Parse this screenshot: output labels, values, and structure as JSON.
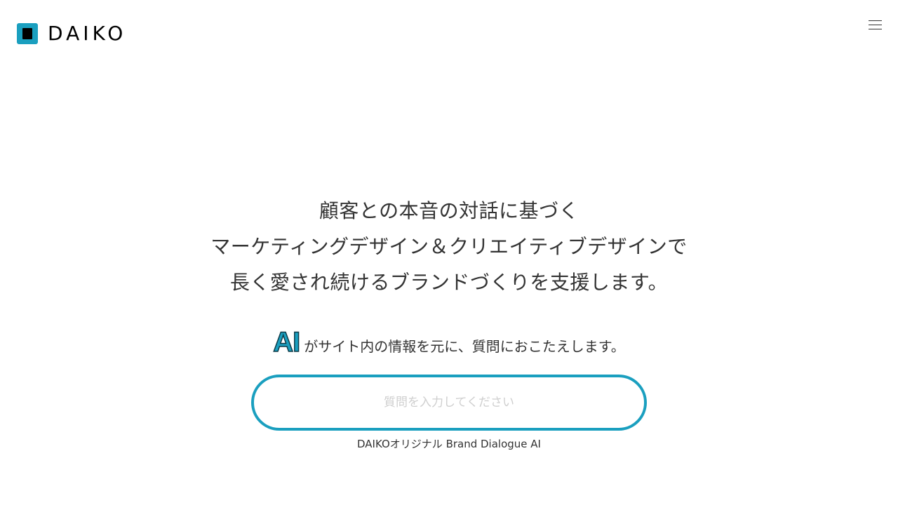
{
  "header": {
    "logo_text": "DAIKO",
    "menu_icon": "hamburger-menu-icon"
  },
  "hero": {
    "lines": [
      "顧客との本音の対話に基づく",
      "マーケティングデザイン＆クリエイティブデザインで",
      "長く愛され続けるブランドづくりを支援します。"
    ]
  },
  "ai_section": {
    "badge": "AI",
    "description": "がサイト内の情報を元に、質問におこたえします。",
    "input_placeholder": "質問を入力してください",
    "input_value": "",
    "caption": "DAIKOオリジナル Brand Dialogue AI"
  },
  "colors": {
    "accent": "#1a9fbf",
    "text": "#333333",
    "background": "#ffffff"
  }
}
